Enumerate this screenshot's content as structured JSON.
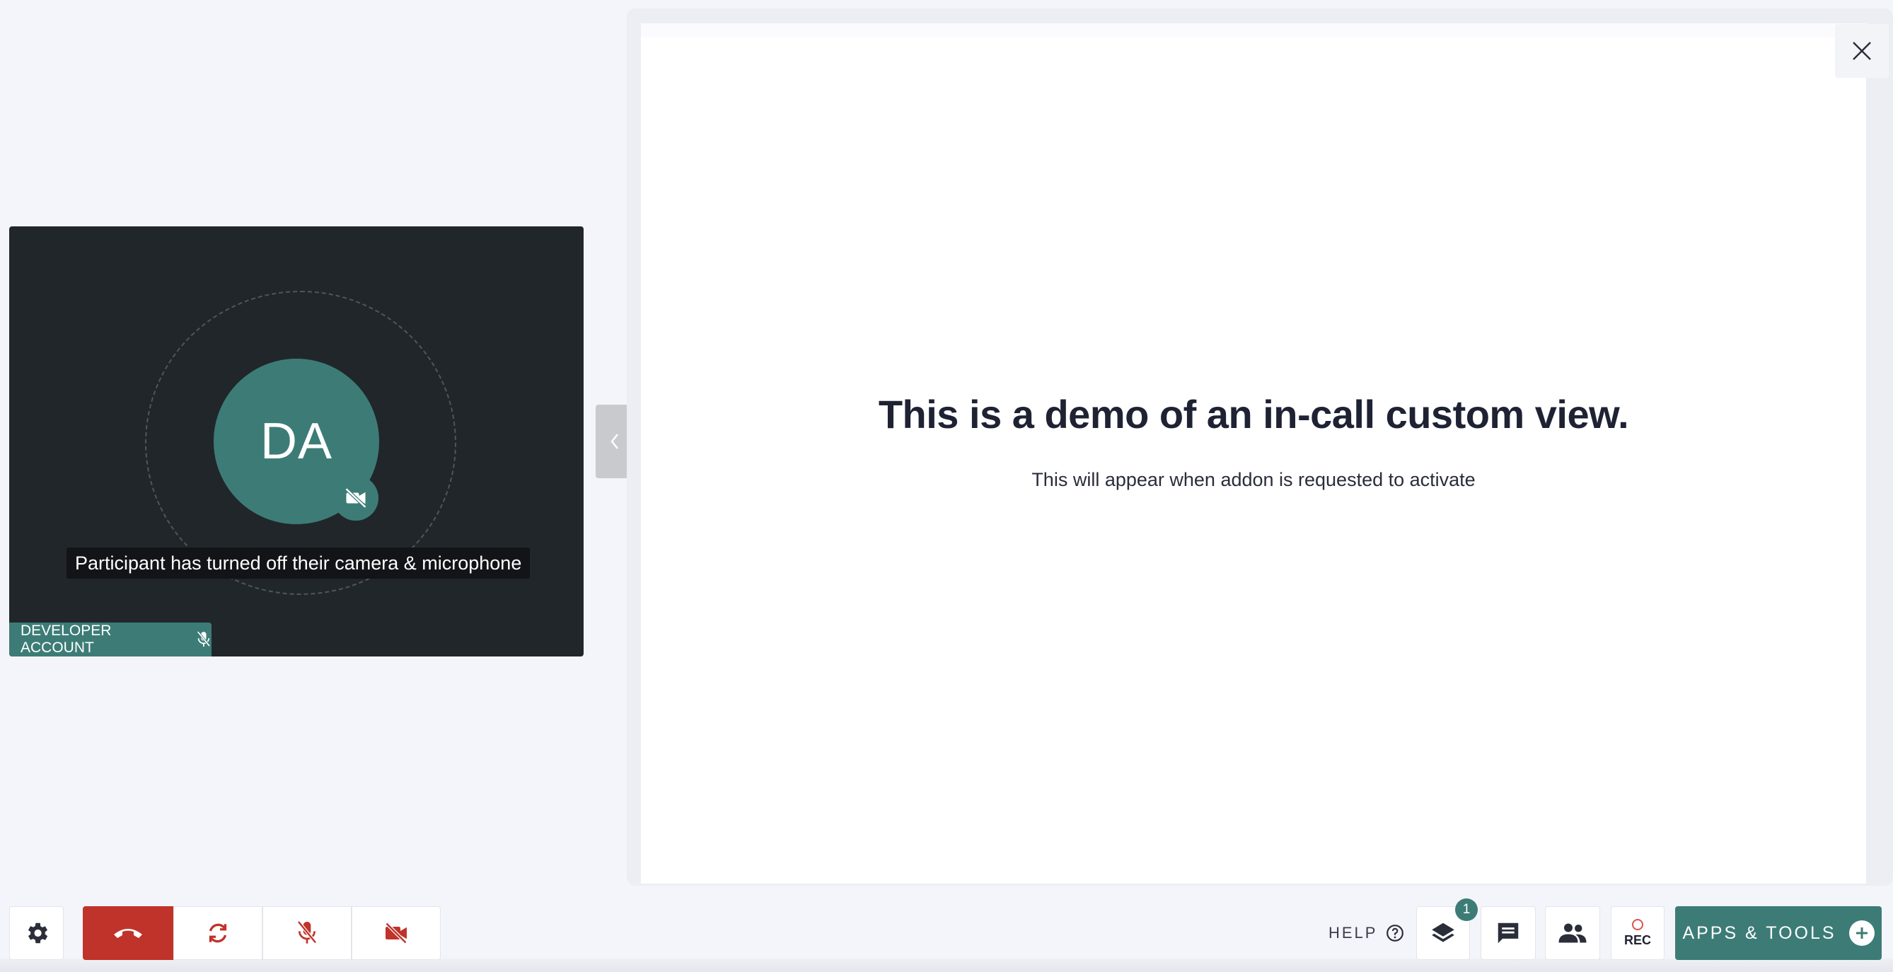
{
  "participant": {
    "initials": "DA",
    "status_caption": "Participant has turned off their camera & microphone",
    "name": "DEVELOPER ACCOUNT"
  },
  "custom_view": {
    "title": "This is a demo of an in-call custom view.",
    "subtitle": "This will appear when addon is requested to activate"
  },
  "toolbar": {
    "help_label": "HELP",
    "layers_badge_count": "1",
    "rec_label": "REC",
    "apps_label": "APPS & TOOLS"
  },
  "colors": {
    "accent": "#3d7c76",
    "danger": "#c0332a",
    "tile_bg": "#21262b",
    "page_bg": "#f4f5fa"
  },
  "icons": {
    "settings": "gear-icon",
    "hangup": "phone-hangup-icon",
    "switch": "refresh-icon",
    "mic": "mic-off-icon",
    "cam": "camera-off-icon",
    "help": "question-circle-icon",
    "layers": "layers-icon",
    "chat": "chat-icon",
    "people": "people-icon",
    "close": "close-icon",
    "apps": "plus-circle-icon"
  }
}
